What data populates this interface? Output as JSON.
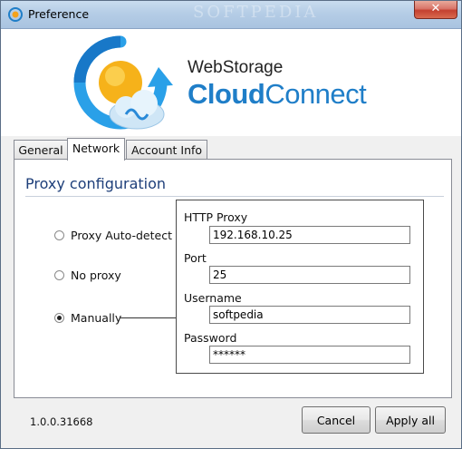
{
  "window": {
    "title": "Preference",
    "watermark": "SOFTPEDIA",
    "close_glyph": "✕",
    "close_color": "#c4402f"
  },
  "banner": {
    "brand_line1": "WebStorage",
    "brand_cloud": "Cloud",
    "brand_connect": "Connect",
    "accent": "#1f7ec8"
  },
  "tabs": [
    {
      "label": "General",
      "active": false
    },
    {
      "label": "Network",
      "active": true
    },
    {
      "label": "Account Info",
      "active": false
    }
  ],
  "proxy": {
    "section_title": "Proxy configuration",
    "options": [
      {
        "label": "Proxy Auto-detect",
        "checked": false
      },
      {
        "label": "No proxy",
        "checked": false
      },
      {
        "label": "Manually",
        "checked": true
      }
    ],
    "fields": {
      "http_proxy": {
        "label": "HTTP Proxy",
        "value": "192.168.10.25"
      },
      "port": {
        "label": "Port",
        "value": "25"
      },
      "username": {
        "label": "Username",
        "value": "softpedia"
      },
      "password": {
        "label": "Password",
        "value": "******"
      }
    }
  },
  "footer": {
    "version": "1.0.0.31668",
    "cancel_label": "Cancel",
    "apply_label": "Apply all"
  }
}
